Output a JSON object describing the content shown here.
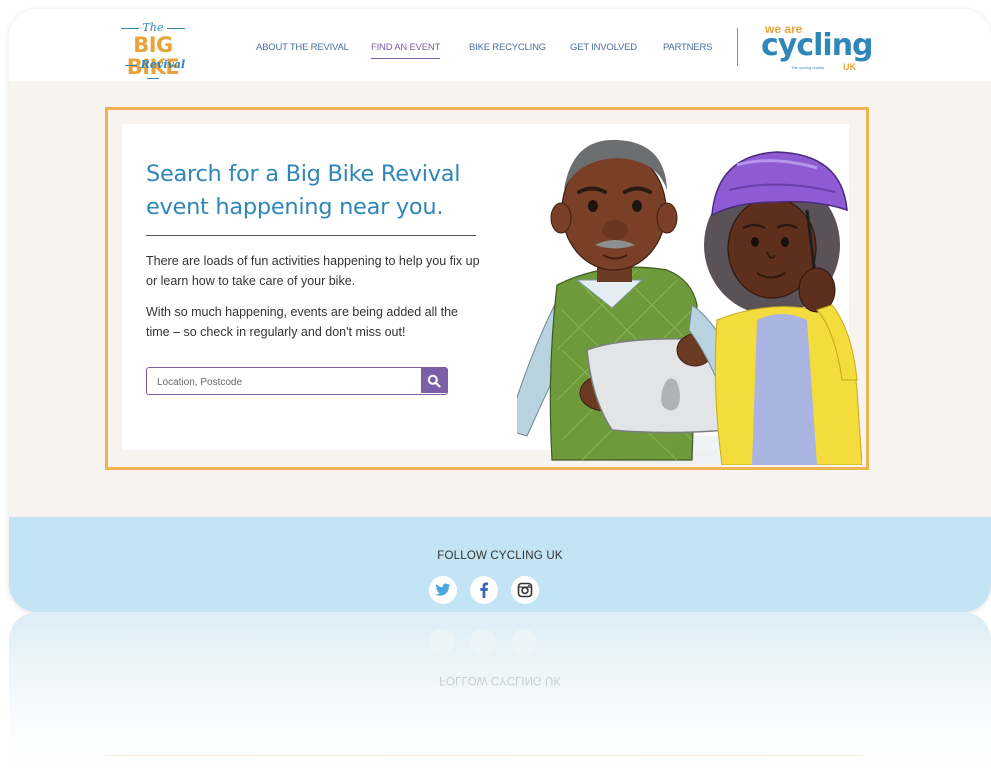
{
  "header": {
    "logo": {
      "the": "The",
      "big_bike": "BIG BIKE",
      "revival": "Revival"
    },
    "nav": [
      {
        "label": "ABOUT THE REVIVAL",
        "active": false
      },
      {
        "label": "FIND AN EVENT",
        "active": true
      },
      {
        "label": "BIKE RECYCLING",
        "active": false
      },
      {
        "label": "GET INVOLVED",
        "active": false
      },
      {
        "label": "PARTNERS",
        "active": false
      }
    ],
    "partner_logo": {
      "we_are": "we are",
      "cycling": "cycling",
      "uk": "UK",
      "tagline": "The cycling charity"
    }
  },
  "hero": {
    "title": "Search for a Big Bike Revival event happening near you.",
    "paragraph1": "There are loads of fun activities happening to help you fix up or learn how to take care of your bike.",
    "paragraph2": "With so much happening, events are being added all the time – so check in regularly and don't miss out!",
    "search": {
      "placeholder": "Location, Postcode",
      "value": ""
    }
  },
  "footer": {
    "follow_label": "FOLLOW CYCLING UK",
    "social": [
      "twitter-icon",
      "facebook-icon",
      "instagram-icon"
    ]
  },
  "colors": {
    "brand_blue": "#2f86b8",
    "brand_orange": "#e8a43a",
    "accent_purple": "#7b5ea6",
    "footer_bg": "#c3e4f4",
    "page_bg": "#f7f3ee"
  }
}
